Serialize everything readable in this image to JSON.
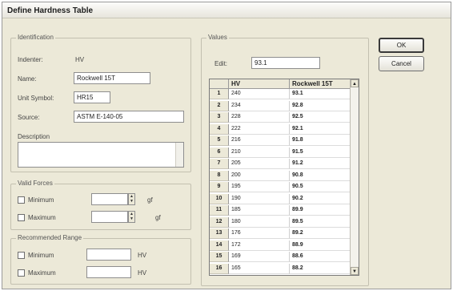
{
  "window": {
    "title": "Define Hardness Table"
  },
  "identification": {
    "legend": "Identification",
    "indenter_label": "Indenter:",
    "indenter_value": "HV",
    "name_label": "Name:",
    "name_value": "Rockwell 15T",
    "unit_label": "Unit Symbol:",
    "unit_value": "HR15",
    "source_label": "Source:",
    "source_value": "ASTM E-140-05",
    "description_label": "Description"
  },
  "valid_forces": {
    "legend": "Valid Forces",
    "minimum_label": "Minimum",
    "maximum_label": "Maximum",
    "unit": "gf"
  },
  "recommended_range": {
    "legend": "Recommended Range",
    "minimum_label": "Minimum",
    "maximum_label": "Maximum",
    "unit": "HV"
  },
  "values": {
    "legend": "Values",
    "edit_label": "Edit:",
    "edit_value": "93.1",
    "col_hv": "HV",
    "col_rockwell": "Rockwell 15T",
    "rows": [
      {
        "n": "1",
        "hv": "240",
        "rw": "93.1"
      },
      {
        "n": "2",
        "hv": "234",
        "rw": "92.8"
      },
      {
        "n": "3",
        "hv": "228",
        "rw": "92.5"
      },
      {
        "n": "4",
        "hv": "222",
        "rw": "92.1"
      },
      {
        "n": "5",
        "hv": "216",
        "rw": "91.8"
      },
      {
        "n": "6",
        "hv": "210",
        "rw": "91.5"
      },
      {
        "n": "7",
        "hv": "205",
        "rw": "91.2"
      },
      {
        "n": "8",
        "hv": "200",
        "rw": "90.8"
      },
      {
        "n": "9",
        "hv": "195",
        "rw": "90.5"
      },
      {
        "n": "10",
        "hv": "190",
        "rw": "90.2"
      },
      {
        "n": "11",
        "hv": "185",
        "rw": "89.9"
      },
      {
        "n": "12",
        "hv": "180",
        "rw": "89.5"
      },
      {
        "n": "13",
        "hv": "176",
        "rw": "89.2"
      },
      {
        "n": "14",
        "hv": "172",
        "rw": "88.9"
      },
      {
        "n": "15",
        "hv": "169",
        "rw": "88.6"
      },
      {
        "n": "16",
        "hv": "165",
        "rw": "88.2"
      }
    ]
  },
  "buttons": {
    "ok": "OK",
    "cancel": "Cancel"
  }
}
